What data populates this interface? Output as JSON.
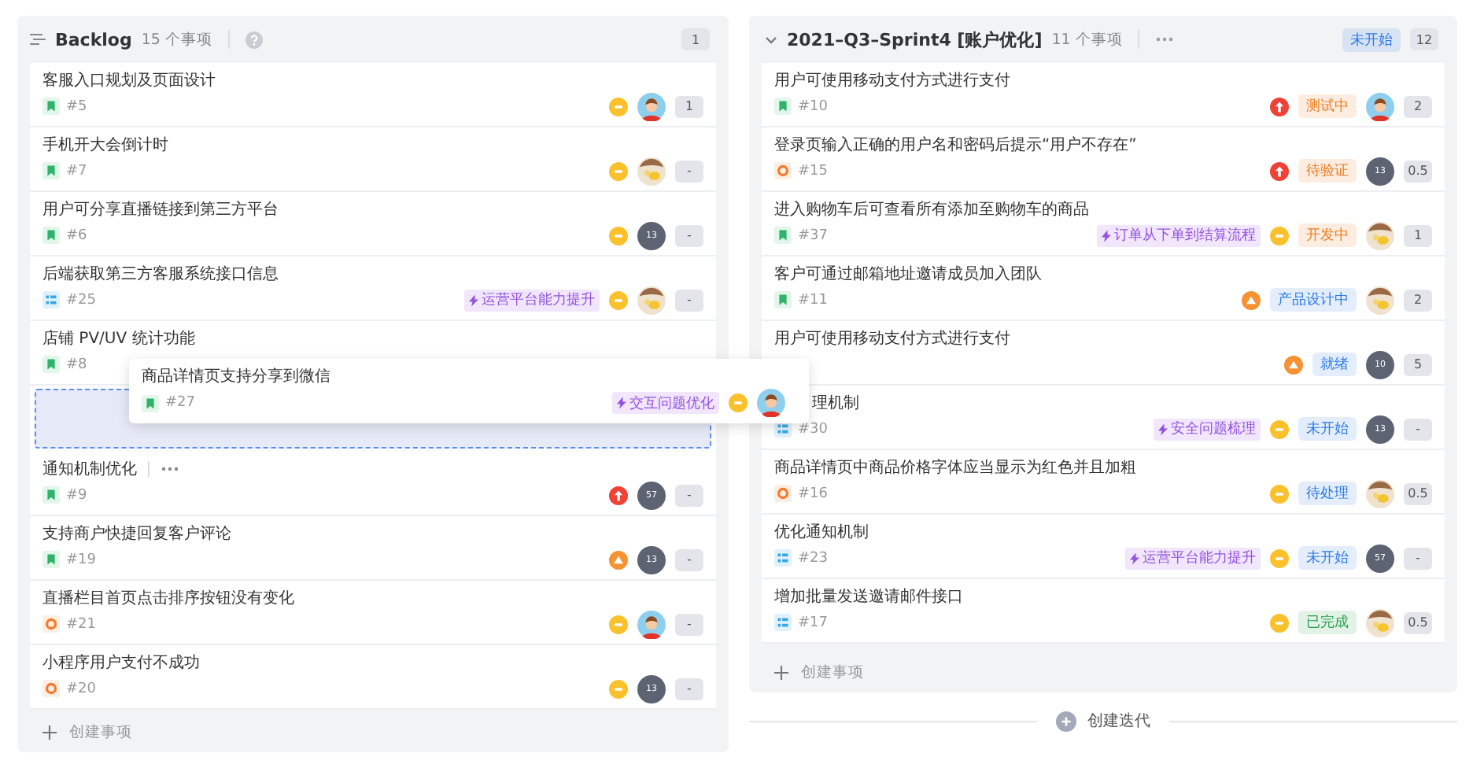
{
  "backlog": {
    "title": "Backlog",
    "count": "15 个事项",
    "badge": "1",
    "cards": [
      {
        "kind": "issue",
        "title": "客服入口规划及页面设计",
        "type_icon": {
          "kind": "story"
        },
        "id": "#5",
        "priority_icon": {
          "kind": "medium"
        },
        "avatar": {
          "kind": "person"
        },
        "estimate": "1"
      },
      {
        "kind": "issue",
        "title": "手机开大会倒计时",
        "type_icon": {
          "kind": "story"
        },
        "id": "#7",
        "priority_icon": {
          "kind": "medium"
        },
        "avatar": {
          "kind": "cartoon"
        },
        "estimate": "-"
      },
      {
        "kind": "issue",
        "title": "用户可分享直播链接到第三方平台",
        "type_icon": {
          "kind": "story"
        },
        "id": "#6",
        "priority_icon": {
          "kind": "medium"
        },
        "avatar": {
          "kind": "initials",
          "text": "13"
        },
        "estimate": "-"
      },
      {
        "kind": "issue",
        "title": "后端获取第三方客服系统接口信息",
        "type_icon": {
          "kind": "task"
        },
        "id": "#25",
        "epic": "运营平台能力提升",
        "priority_icon": {
          "kind": "medium"
        },
        "avatar": {
          "kind": "cartoon"
        },
        "estimate": "-"
      },
      {
        "kind": "issue",
        "title": "店铺 PV/UV 统计功能",
        "type_icon": {
          "kind": "story"
        },
        "id": "#8"
      },
      {
        "kind": "placeholder"
      },
      {
        "kind": "issue",
        "title": "通知机制优化",
        "show_more": true,
        "type_icon": {
          "kind": "story"
        },
        "id": "#9",
        "priority_icon": {
          "kind": "high"
        },
        "avatar": {
          "kind": "initials",
          "text": "57"
        },
        "estimate": "-"
      },
      {
        "kind": "issue",
        "title": "支持商户快捷回复客户评论",
        "type_icon": {
          "kind": "story"
        },
        "id": "#19",
        "priority_icon": {
          "kind": "raised"
        },
        "avatar": {
          "kind": "initials",
          "text": "13"
        },
        "estimate": "-"
      },
      {
        "kind": "issue",
        "title": "直播栏目首页点击排序按钮没有变化",
        "type_icon": {
          "kind": "bug"
        },
        "id": "#21",
        "priority_icon": {
          "kind": "medium"
        },
        "avatar": {
          "kind": "person"
        },
        "estimate": "-"
      },
      {
        "kind": "issue",
        "title": "小程序用户支付不成功",
        "type_icon": {
          "kind": "bug"
        },
        "id": "#20",
        "priority_icon": {
          "kind": "medium"
        },
        "avatar": {
          "kind": "initials",
          "text": "13"
        },
        "estimate": "-"
      }
    ],
    "create": "创建事项"
  },
  "sprint": {
    "title": "2021–Q3–Sprint4 [账户优化]",
    "count": "11 个事项",
    "status": {
      "text": "未开始",
      "color": "#2c7be5"
    },
    "badge": "12",
    "cards": [
      {
        "kind": "issue",
        "title": "用户可使用移动支付方式进行支付",
        "type_icon": {
          "kind": "story"
        },
        "id": "#10",
        "priority_icon": {
          "kind": "high"
        },
        "status": {
          "text": "测试中",
          "color": "#f07b1c"
        },
        "avatar": {
          "kind": "person"
        },
        "estimate": "2"
      },
      {
        "kind": "issue",
        "title": "登录页输入正确的用户名和密码后提示“用户不存在”",
        "type_icon": {
          "kind": "bug"
        },
        "id": "#15",
        "priority_icon": {
          "kind": "high"
        },
        "status": {
          "text": "待验证",
          "color": "#f07b1c"
        },
        "avatar": {
          "kind": "initials",
          "text": "13"
        },
        "estimate": "0.5"
      },
      {
        "kind": "issue",
        "title": "进入购物车后可查看所有添加至购物车的商品",
        "type_icon": {
          "kind": "story"
        },
        "id": "#37",
        "epic": "订单从下单到结算流程",
        "priority_icon": {
          "kind": "medium"
        },
        "status": {
          "text": "开发中",
          "color": "#f07b1c"
        },
        "avatar": {
          "kind": "cartoon"
        },
        "estimate": "1"
      },
      {
        "kind": "issue",
        "title": "客户可通过邮箱地址邀请成员加入团队",
        "type_icon": {
          "kind": "story"
        },
        "id": "#11",
        "priority_icon": {
          "kind": "raised"
        },
        "status": {
          "text": "产品设计中",
          "color": "#2c7be5"
        },
        "avatar": {
          "kind": "cartoon"
        },
        "estimate": "2"
      },
      {
        "kind": "issue",
        "title": "用户可使用移动支付方式进行支付",
        "priority_icon": {
          "kind": "raised"
        },
        "status": {
          "text": "就绪",
          "color": "#2c7be5"
        },
        "avatar": {
          "kind": "initials",
          "text": "10"
        },
        "estimate": "5"
      },
      {
        "kind": "issue",
        "title": "理机制",
        "indent_title": true,
        "type_icon": {
          "kind": "task"
        },
        "id": "#30",
        "epic": "安全问题梳理",
        "priority_icon": {
          "kind": "medium"
        },
        "status": {
          "text": "未开始",
          "color": "#2c7be5"
        },
        "avatar": {
          "kind": "initials",
          "text": "13"
        },
        "estimate": "-"
      },
      {
        "kind": "issue",
        "title": "商品详情页中商品价格字体应当显示为红色并且加粗",
        "type_icon": {
          "kind": "bug"
        },
        "id": "#16",
        "priority_icon": {
          "kind": "medium"
        },
        "status": {
          "text": "待处理",
          "color": "#2c7be5"
        },
        "avatar": {
          "kind": "cartoon"
        },
        "estimate": "0.5"
      },
      {
        "kind": "issue",
        "title": "优化通知机制",
        "type_icon": {
          "kind": "task"
        },
        "id": "#23",
        "epic": "运营平台能力提升",
        "priority_icon": {
          "kind": "medium"
        },
        "status": {
          "text": "未开始",
          "color": "#2c7be5"
        },
        "avatar": {
          "kind": "initials",
          "text": "57"
        },
        "estimate": "-"
      },
      {
        "kind": "issue",
        "title": "增加批量发送邀请邮件接口",
        "type_icon": {
          "kind": "task"
        },
        "id": "#17",
        "priority_icon": {
          "kind": "medium"
        },
        "status": {
          "text": "已完成",
          "color": "#26a04a"
        },
        "avatar": {
          "kind": "cartoon"
        },
        "estimate": "0.5"
      }
    ],
    "create": "创建事项"
  },
  "dragged_card": {
    "title": "商品详情页支持分享到微信",
    "type_icon": {
      "kind": "story"
    },
    "id": "#27",
    "epic": "交互问题优化",
    "priority_icon": {
      "kind": "medium"
    },
    "avatar": {
      "kind": "person"
    }
  },
  "create_sprint": "创建迭代"
}
